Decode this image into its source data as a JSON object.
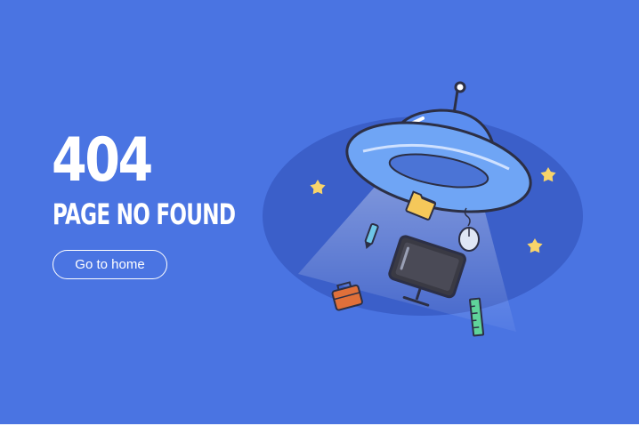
{
  "error": {
    "code": "404",
    "message": "PAGE NO FOUND"
  },
  "actions": {
    "home_label": "Go to home"
  },
  "colors": {
    "background": "#4a74e2",
    "ellipse": "#3b5fc9",
    "ufo_dome": "#5b8ef0",
    "ufo_rim": "#6fa5f5",
    "star": "#f8d46a",
    "folder": "#f5c85a",
    "briefcase": "#e0703a",
    "ruler": "#5fd39a",
    "outline": "#2c2f45"
  },
  "illustration": {
    "icons": [
      "ufo-icon",
      "folder-icon",
      "mouse-icon",
      "pen-icon",
      "monitor-icon",
      "briefcase-icon",
      "ruler-icon",
      "star-icon"
    ]
  }
}
